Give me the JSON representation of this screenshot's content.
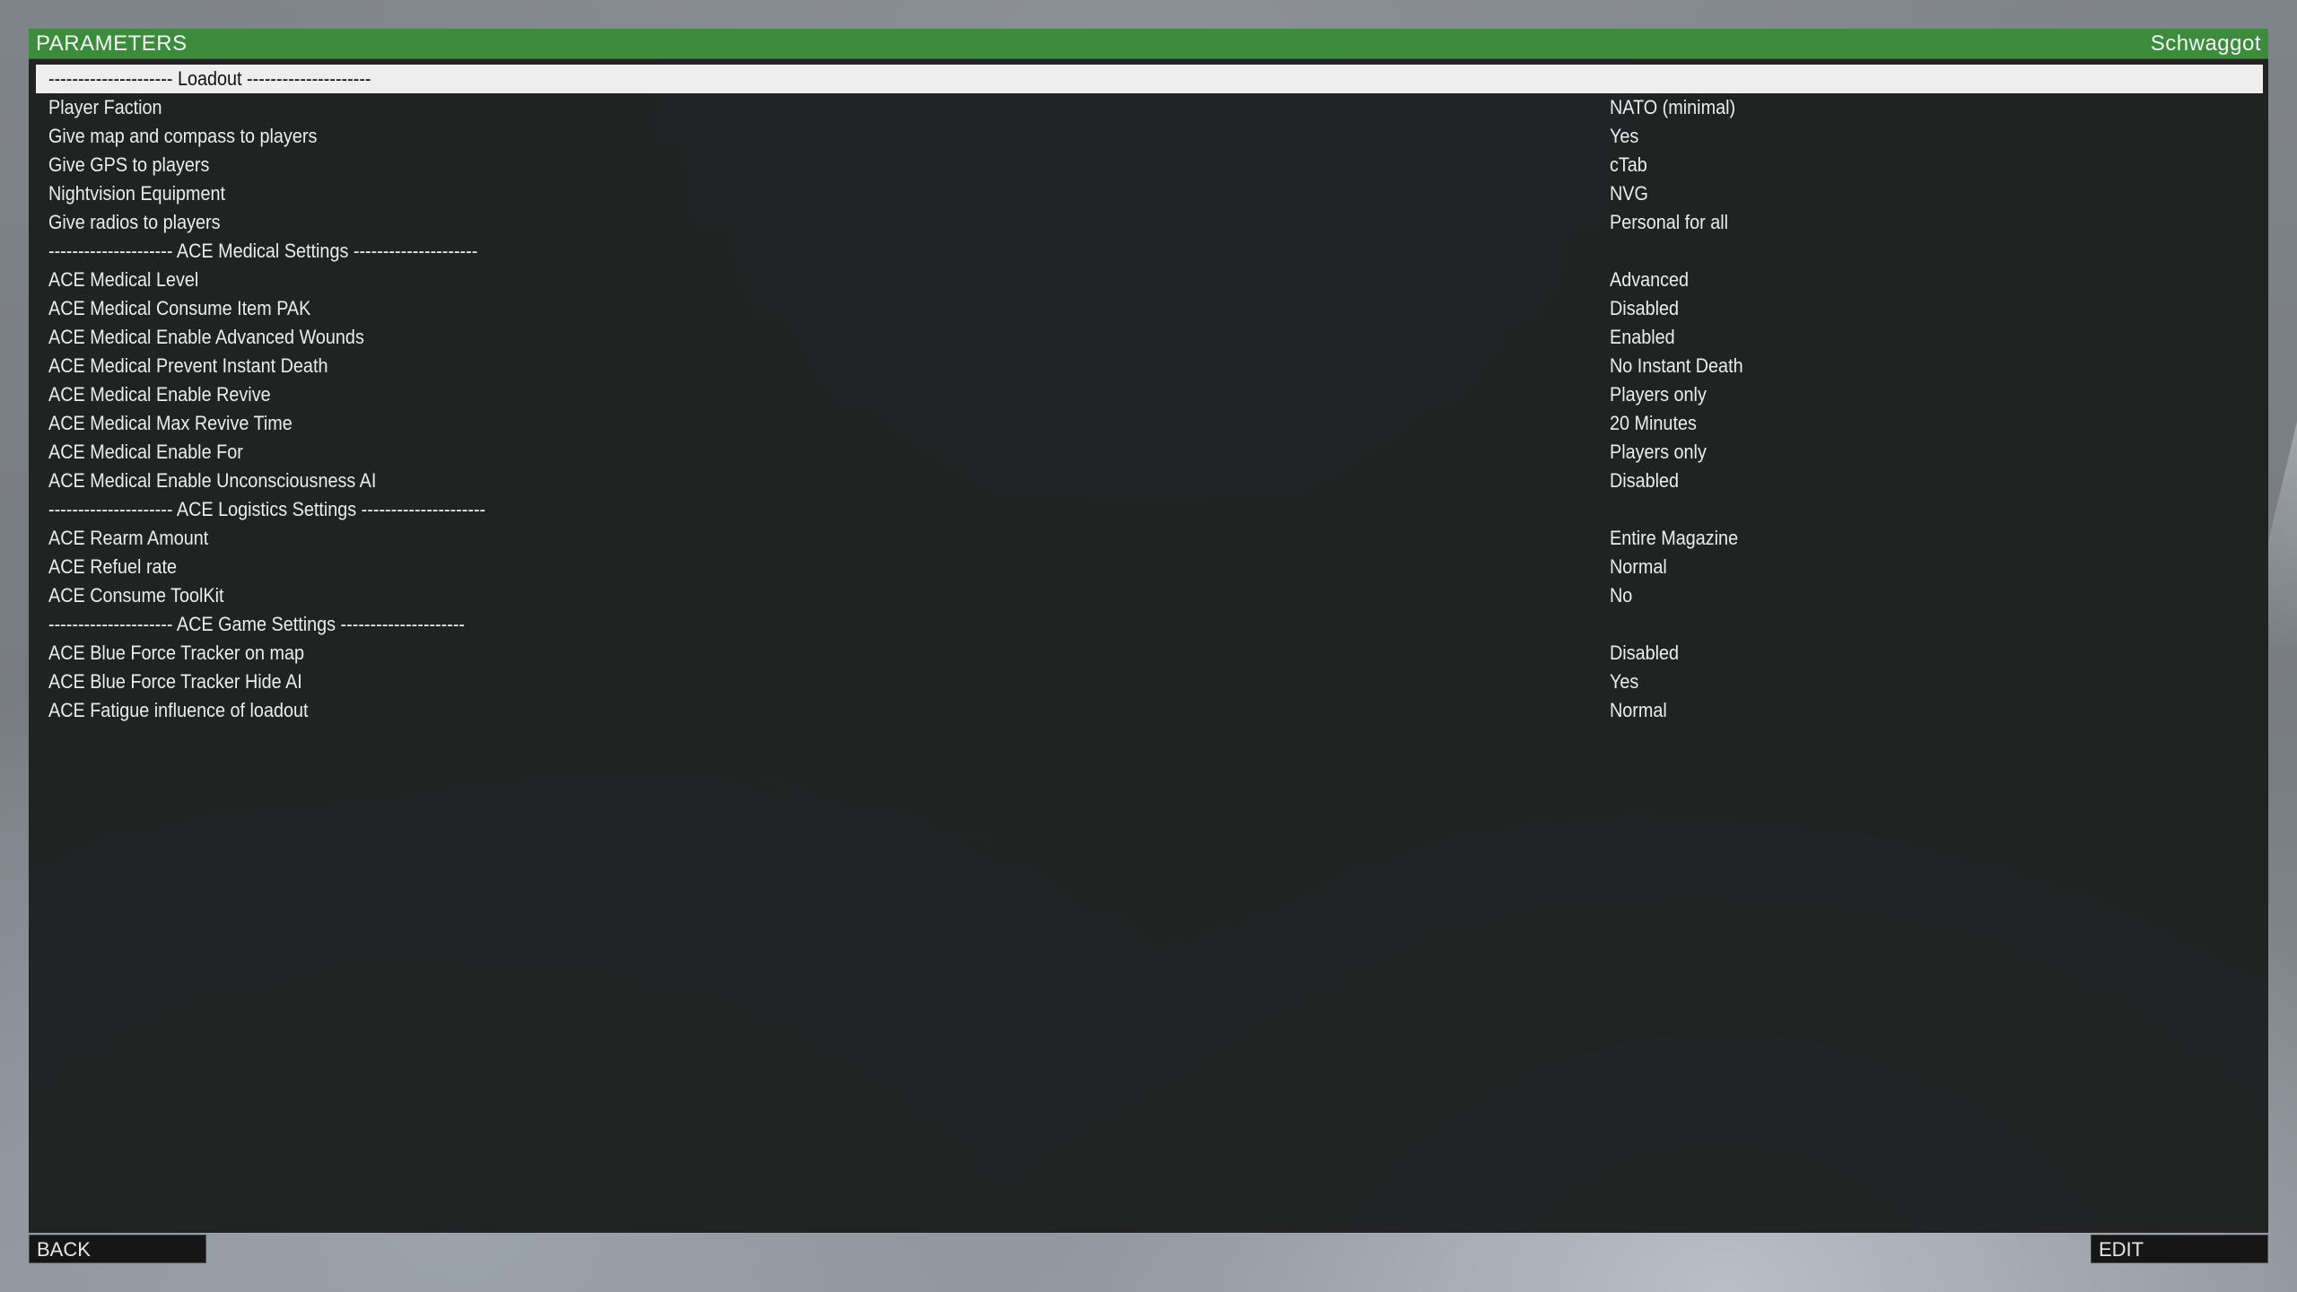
{
  "window": {
    "title": "PARAMETERS",
    "user": "Schwaggot"
  },
  "parameters": [
    {
      "label": "--------------------- Loadout ---------------------",
      "value": ""
    },
    {
      "label": "Player Faction",
      "value": "NATO (minimal)"
    },
    {
      "label": "Give map and compass to players",
      "value": "Yes"
    },
    {
      "label": "Give GPS to players",
      "value": "cTab"
    },
    {
      "label": "Nightvision Equipment",
      "value": "NVG"
    },
    {
      "label": "Give radios to players",
      "value": "Personal for all"
    },
    {
      "label": "--------------------- ACE Medical Settings ---------------------",
      "value": ""
    },
    {
      "label": "ACE Medical Level",
      "value": "Advanced"
    },
    {
      "label": "ACE Medical Consume Item PAK",
      "value": "Disabled"
    },
    {
      "label": "ACE Medical Enable Advanced Wounds",
      "value": "Enabled"
    },
    {
      "label": "ACE Medical Prevent Instant Death",
      "value": "No Instant Death"
    },
    {
      "label": "ACE Medical Enable Revive",
      "value": "Players only"
    },
    {
      "label": "ACE Medical Max Revive Time",
      "value": "20 Minutes"
    },
    {
      "label": "ACE Medical Enable For",
      "value": "Players only"
    },
    {
      "label": "ACE Medical Enable Unconsciousness AI",
      "value": "Disabled"
    },
    {
      "label": "--------------------- ACE Logistics Settings ---------------------",
      "value": ""
    },
    {
      "label": "ACE Rearm Amount",
      "value": "Entire Magazine"
    },
    {
      "label": "ACE Refuel rate",
      "value": "Normal"
    },
    {
      "label": "ACE Consume ToolKit",
      "value": "No"
    },
    {
      "label": "--------------------- ACE Game Settings ---------------------",
      "value": ""
    },
    {
      "label": "ACE Blue Force Tracker on map",
      "value": "Disabled"
    },
    {
      "label": "ACE Blue Force Tracker Hide AI",
      "value": "Yes"
    },
    {
      "label": "ACE Fatigue influence of loadout",
      "value": "Normal"
    }
  ],
  "buttons": {
    "back": "BACK",
    "edit": "EDIT"
  },
  "colors": {
    "title_bar": "#3d8c3e",
    "panel": "#1e2020",
    "selected_row": "#eeeeee"
  }
}
